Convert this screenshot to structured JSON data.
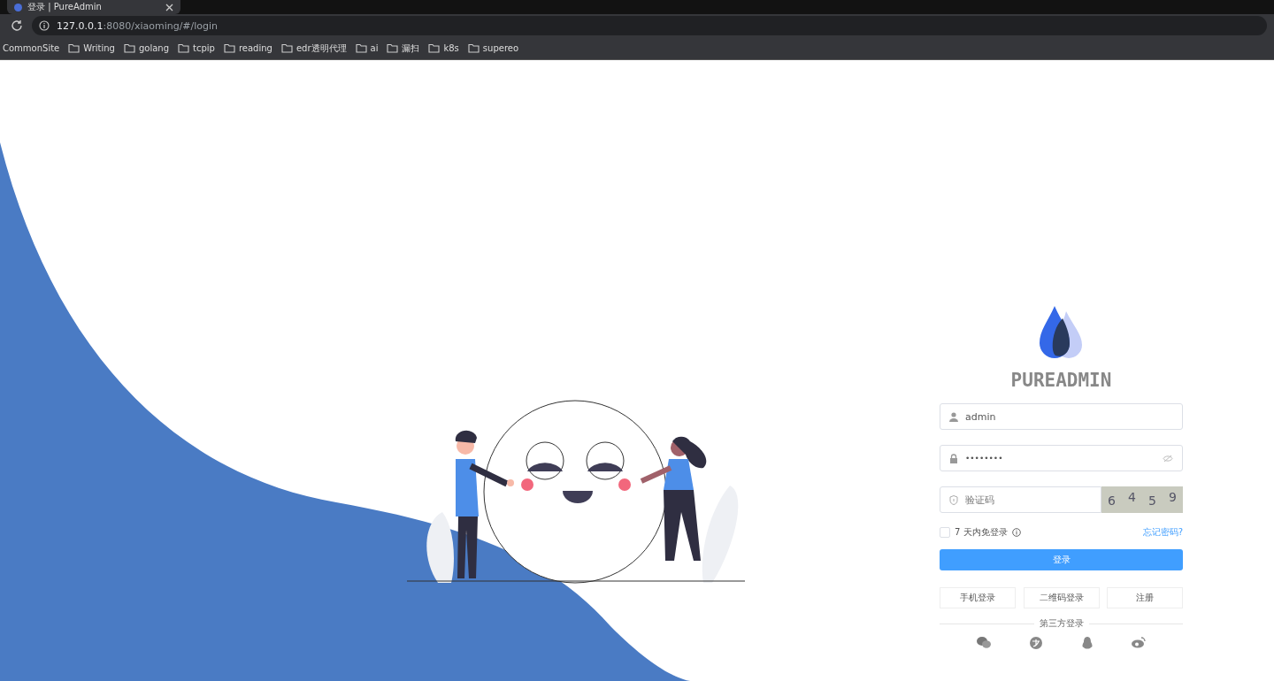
{
  "browser": {
    "tab_title": "登录 | PureAdmin",
    "address": {
      "host": "127.0.0.1",
      "path": ":8080/xiaoming/#/login"
    },
    "bookmarks": [
      {
        "label": "CommonSite",
        "kind": "site"
      },
      {
        "label": "Writing",
        "kind": "folder"
      },
      {
        "label": "golang",
        "kind": "folder"
      },
      {
        "label": "tcpip",
        "kind": "folder"
      },
      {
        "label": "reading",
        "kind": "folder"
      },
      {
        "label": "edr透明代理",
        "kind": "folder"
      },
      {
        "label": "ai",
        "kind": "folder"
      },
      {
        "label": "漏扫",
        "kind": "folder"
      },
      {
        "label": "k8s",
        "kind": "folder"
      },
      {
        "label": "supereo",
        "kind": "folder"
      }
    ]
  },
  "login": {
    "title": "PUREADMIN",
    "username": {
      "value": "admin"
    },
    "password": {
      "value": "••••••••"
    },
    "captcha": {
      "placeholder": "验证码",
      "code": [
        "6",
        "4",
        "5",
        "9"
      ]
    },
    "remember": {
      "label": "7 天内免登录",
      "checked": false
    },
    "forgot_link": "忘记密码?",
    "submit": "登录",
    "alt_buttons": [
      "手机登录",
      "二维码登录",
      "注册"
    ],
    "third_party": {
      "label": "第三方登录",
      "providers": [
        {
          "kind": "wechat"
        },
        {
          "kind": "alipay"
        },
        {
          "kind": "qq"
        },
        {
          "kind": "weibo"
        }
      ]
    }
  }
}
